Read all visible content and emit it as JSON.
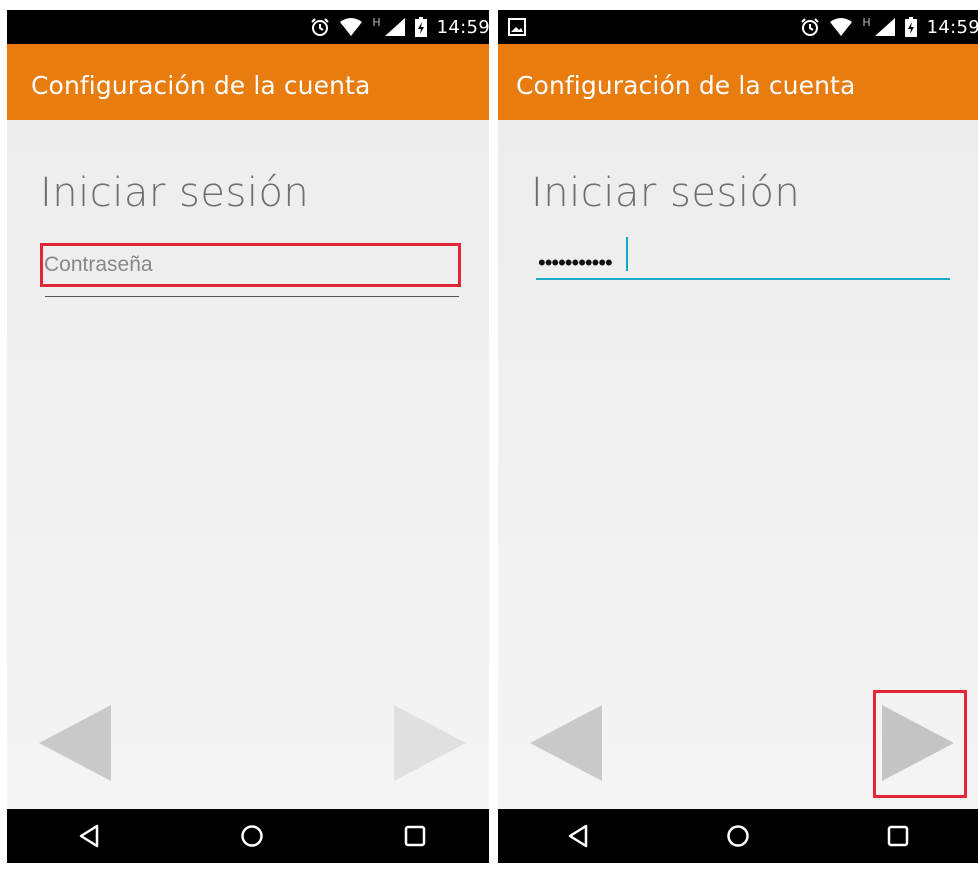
{
  "status_bar": {
    "time": "14:59",
    "icons": [
      "alarm-icon",
      "wifi-icon",
      "h-network-icon",
      "signal-icon",
      "battery-icon"
    ]
  },
  "left_screen": {
    "app_bar_title": "Configuración de la cuenta",
    "heading": "Iniciar sesión",
    "password_field": {
      "placeholder": "Contraseña",
      "value": ""
    }
  },
  "right_screen": {
    "app_bar_title": "Configuración de la cuenta",
    "heading": "Iniciar sesión",
    "password_field": {
      "value": "•••••••••••"
    }
  },
  "colors": {
    "app_bar": "#e87c0f",
    "highlight": "#e32636",
    "field_focus": "#1fa8c9"
  }
}
